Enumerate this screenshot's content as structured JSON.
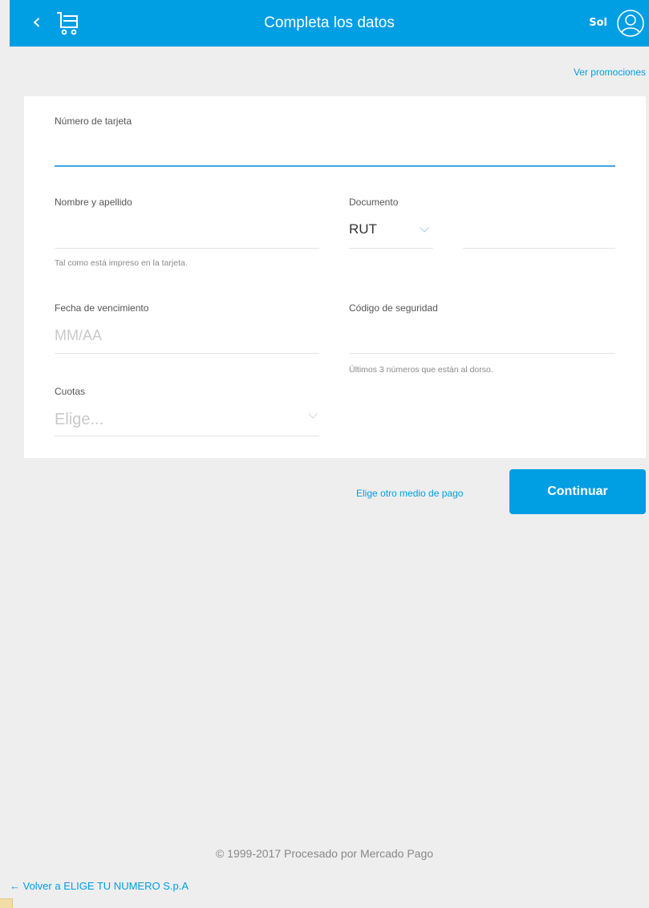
{
  "header": {
    "back_icon": "chevron-left-icon",
    "cart_icon": "cart-icon",
    "title": "Completa los datos",
    "user_name": "Sol",
    "user_icon": "user-avatar-icon",
    "bg_color": "#009ee3"
  },
  "promotions_link": "Ver promociones",
  "form": {
    "card_number": {
      "label": "Número de tarjeta",
      "value": ""
    },
    "name": {
      "label": "Nombre y apellido",
      "value": "",
      "hint": "Tal como está impreso en la tarjeta."
    },
    "document": {
      "label": "Documento",
      "type_selected": "RUT",
      "number_value": ""
    },
    "expiry": {
      "label": "Fecha de vencimiento",
      "placeholder": "MM/AA"
    },
    "security_code": {
      "label": "Código de seguridad",
      "value": "",
      "hint": "Últimos 3 números que están al dorso."
    },
    "installments": {
      "label": "Cuotas",
      "placeholder": "Elige..."
    }
  },
  "actions": {
    "other_method": "Elige otro medio de pago",
    "continue": "Continuar"
  },
  "footer": {
    "copyright": "© 1999-2017 Procesado por Mercado Pago",
    "back_link": "← Volver a ELIGE TU NUMERO S.p.A"
  },
  "colors": {
    "accent": "#009ee3",
    "page_bg": "#eeeeee",
    "card_bg": "#ffffff"
  }
}
